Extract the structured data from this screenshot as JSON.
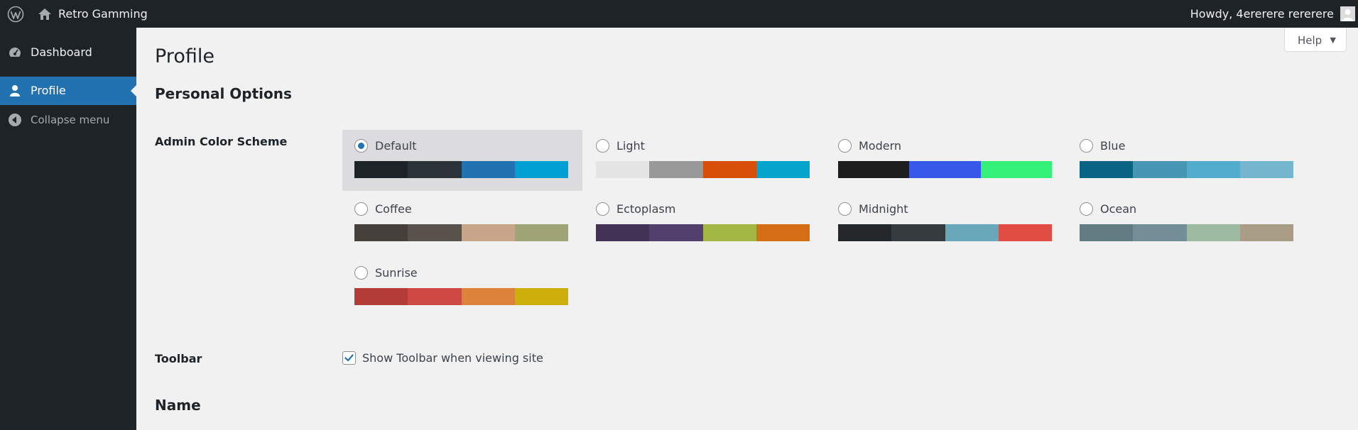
{
  "adminbar": {
    "site_name": "Retro Gamming",
    "howdy": "Howdy, 4ererere rererere"
  },
  "sidebar": {
    "items": [
      {
        "label": "Dashboard",
        "icon": "dashboard-gauge-icon",
        "active": false
      },
      {
        "label": "Profile",
        "icon": "user-icon",
        "active": true
      },
      {
        "label": "Collapse menu",
        "icon": "collapse-arrow-icon",
        "active": false
      }
    ]
  },
  "help": {
    "label": "Help",
    "arrow": "▼"
  },
  "page": {
    "title": "Profile",
    "personal_options": "Personal Options",
    "admin_color_scheme_label": "Admin Color Scheme",
    "toolbar_label": "Toolbar",
    "toolbar_checkbox_text": "Show Toolbar when viewing site",
    "toolbar_checked": true,
    "name_section": "Name"
  },
  "color_schemes": [
    {
      "name": "Default",
      "selected": true,
      "colors": [
        "#1d2327",
        "#2c3338",
        "#2271b1",
        "#00a0d2"
      ]
    },
    {
      "name": "Light",
      "selected": false,
      "colors": [
        "#e5e5e5",
        "#999999",
        "#d64e07",
        "#04a4cc"
      ]
    },
    {
      "name": "Modern",
      "selected": false,
      "colors": [
        "#1e1e1e",
        "#3858e9",
        "#33f078"
      ]
    },
    {
      "name": "Blue",
      "selected": false,
      "colors": [
        "#096484",
        "#4796b3",
        "#52accc",
        "#74b6ce"
      ]
    },
    {
      "name": "Coffee",
      "selected": false,
      "colors": [
        "#46403c",
        "#59524c",
        "#c7a589",
        "#9ea476"
      ]
    },
    {
      "name": "Ectoplasm",
      "selected": false,
      "colors": [
        "#413256",
        "#523f6d",
        "#a3b745",
        "#d46f15"
      ]
    },
    {
      "name": "Midnight",
      "selected": false,
      "colors": [
        "#25282b",
        "#363b3f",
        "#69a8bb",
        "#e14d43"
      ]
    },
    {
      "name": "Ocean",
      "selected": false,
      "colors": [
        "#627c83",
        "#738e96",
        "#9ebaa0",
        "#aa9d88"
      ]
    },
    {
      "name": "Sunrise",
      "selected": false,
      "colors": [
        "#b43c38",
        "#cf4944",
        "#dd823b",
        "#ccaf0b"
      ]
    }
  ],
  "colors": {
    "adminbar_bg": "#1d2327",
    "accent": "#2271b1",
    "page_bg": "#f1f1f1"
  }
}
